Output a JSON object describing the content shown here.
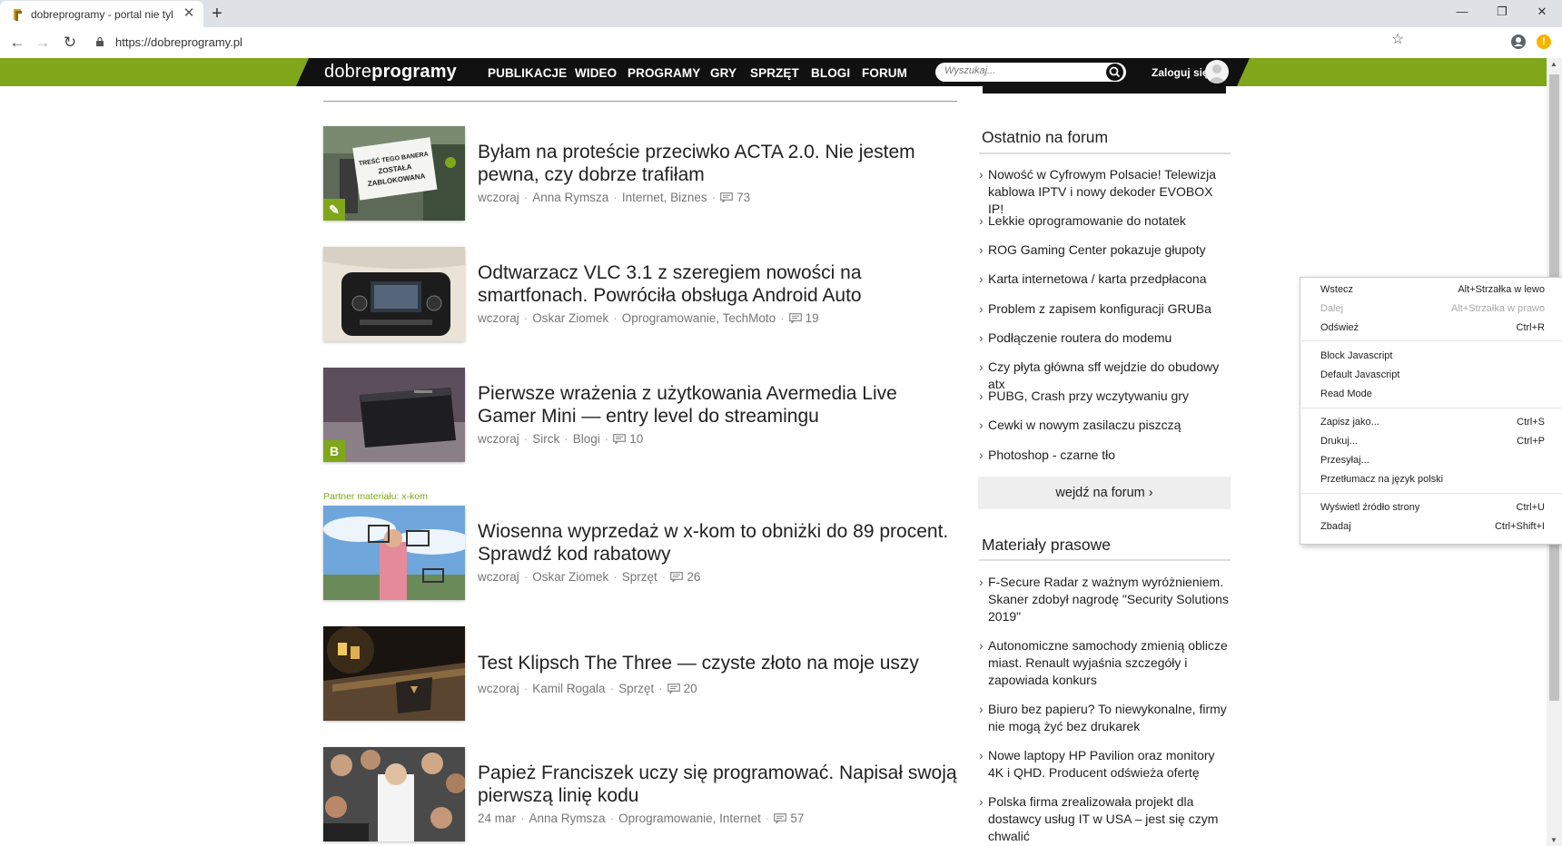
{
  "browser": {
    "tab_title": "dobreprogramy - portal nie tylko o programach",
    "new_tab_symbol": "+",
    "close_symbol": "✕",
    "url": "https://dobreprogramy.pl",
    "window_controls": {
      "minimize": "—",
      "maximize": "❐",
      "close": "✕"
    },
    "icons": [
      "back-arrow-icon",
      "forward-arrow-icon",
      "reload-icon",
      "lock-icon",
      "bookmark-star-icon",
      "profile-icon",
      "extension-icon"
    ]
  },
  "site": {
    "logo_light": "dobre",
    "logo_bold": "programy",
    "nav": [
      "PUBLIKACJE",
      "WIDEO",
      "PROGRAMY",
      "GRY",
      "SPRZĘT",
      "BLOGI",
      "FORUM"
    ],
    "search_placeholder": "Wyszukaj...",
    "login_label": "Zaloguj się",
    "accent_color": "#7fa719"
  },
  "articles": [
    {
      "title": "Byłam na proteście przeciwko ACTA 2.0. Nie jestem pewna, czy dobrze trafiłam",
      "date": "wczoraj",
      "author": "Anna Rymsza",
      "category": "Internet, Biznes",
      "comments": "73",
      "badge": "✎",
      "sign_lines": [
        "TREŚĆ TEGO BANERA",
        "ZOSTAŁA",
        "ZABLOKOWANA"
      ]
    },
    {
      "title": "Odtwarzacz VLC 3.1 z szeregiem nowości na smartfonach. Powróciła obsługa Android Auto",
      "date": "wczoraj",
      "author": "Oskar Ziomek",
      "category": "Oprogramowanie, TechMoto",
      "comments": "19"
    },
    {
      "title": "Pierwsze wrażenia z użytkowania Avermedia Live Gamer Mini — entry level do streamingu",
      "date": "wczoraj",
      "author": "Sirck",
      "category": "Blogi",
      "comments": "10",
      "badge": "B"
    },
    {
      "title": "Wiosenna wyprzedaż w x-kom to obniżki do 89 procent. Sprawdź kod rabatowy",
      "date": "wczoraj",
      "author": "Oskar Ziomek",
      "category": "Sprzęt",
      "comments": "26",
      "partner_label": "Partner materiału: x-kom"
    },
    {
      "title": "Test Klipsch The Three — czyste złoto na moje uszy",
      "date": "wczoraj",
      "author": "Kamil Rogala",
      "category": "Sprzęt",
      "comments": "20"
    },
    {
      "title": "Papież Franciszek uczy się programować. Napisał swoją pierwszą linię kodu",
      "date": "24 mar",
      "author": "Anna Rymsza",
      "category": "Oprogramowanie, Internet",
      "comments": "57"
    }
  ],
  "sidebar": {
    "forum_heading": "Ostatnio na forum",
    "forum_items": [
      "Nowość w Cyfrowym Polsacie! Telewizja kablowa IPTV i nowy dekoder EVOBOX IP!",
      "Lekkie oprogramowanie do notatek",
      "ROG Gaming Center pokazuje głupoty",
      "Karta internetowa / karta przedpłacona",
      "Problem z zapisem konfiguracji GRUBa",
      "Podłączenie routera do modemu",
      "Czy płyta główna sff wejdzie do obudowy atx",
      "PUBG, Crash przy wczytywaniu gry",
      "Cewki w nowym zasilaczu piszczą",
      "Photoshop - czarne tło"
    ],
    "forum_button": "wejdź na forum ›",
    "press_heading": "Materiały prasowe",
    "press_items": [
      "F-Secure Radar z ważnym wyróżnieniem. Skaner zdobył nagrodę \"Security Solutions 2019\"",
      "Autonomiczne samochody zmienią oblicze miast. Renault wyjaśnia szczegóły i zapowiada konkurs",
      "Biuro bez papieru? To niewykonalne, firmy nie mogą żyć bez drukarek",
      "Nowe laptopy HP Pavilion oraz monitory 4K i QHD. Producent odświeża ofertę",
      "Polska firma zrealizowała projekt dla dostawcy usług IT w USA – jest się czym chwalić"
    ]
  },
  "context_menu": {
    "items": [
      {
        "label": "Wstecz",
        "shortcut": "Alt+Strzałka w lewo",
        "disabled": false
      },
      {
        "label": "Dalej",
        "shortcut": "Alt+Strzałka w prawo",
        "disabled": true
      },
      {
        "label": "Odśwież",
        "shortcut": "Ctrl+R",
        "disabled": false
      },
      {
        "label": "Block Javascript",
        "shortcut": "",
        "disabled": false
      },
      {
        "label": "Default Javascript",
        "shortcut": "",
        "disabled": false
      },
      {
        "label": "Read Mode",
        "shortcut": "",
        "disabled": false
      },
      {
        "label": "Zapisz jako...",
        "shortcut": "Ctrl+S",
        "disabled": false
      },
      {
        "label": "Drukuj...",
        "shortcut": "Ctrl+P",
        "disabled": false
      },
      {
        "label": "Przesyłaj...",
        "shortcut": "",
        "disabled": false
      },
      {
        "label": "Przetłumacz na język polski",
        "shortcut": "",
        "disabled": false
      },
      {
        "label": "Wyświetl źródło strony",
        "shortcut": "Ctrl+U",
        "disabled": false
      },
      {
        "label": "Zbadaj",
        "shortcut": "Ctrl+Shift+I",
        "disabled": false
      }
    ]
  }
}
